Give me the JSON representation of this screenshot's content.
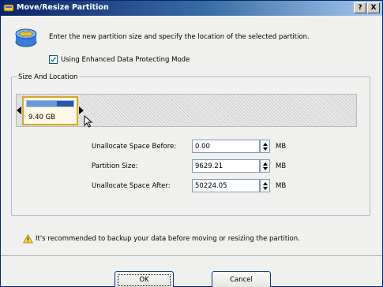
{
  "window": {
    "title": "Move/Resize Partition",
    "help_button": "?",
    "close_button": "X"
  },
  "instructions": "Enter the new partition size and specify the location of the selected partition.",
  "protect_mode": {
    "label": "Using Enhanced Data Protecting Mode",
    "checked": true
  },
  "size_location": {
    "group_title": "Size And Location",
    "partition": {
      "size_text": "9.40 GB",
      "used_fraction": 0.65
    }
  },
  "fields": {
    "before": {
      "label": "Unallocate Space Before:",
      "value": "0.00",
      "unit": "MB"
    },
    "size": {
      "label": "Partition Size:",
      "value": "9629.21",
      "unit": "MB"
    },
    "after": {
      "label": "Unallocate Space After:",
      "value": "50224.05",
      "unit": "MB"
    }
  },
  "warning": "It's recommended to backup your data before moving or resizing the partition.",
  "buttons": {
    "ok": "OK",
    "cancel": "Cancel"
  }
}
